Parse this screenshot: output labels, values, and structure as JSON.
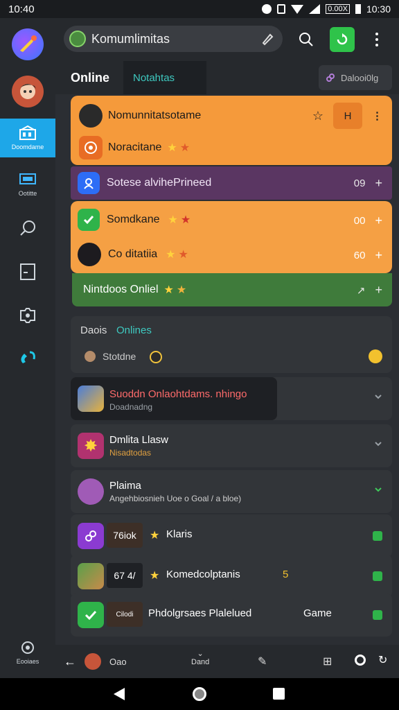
{
  "status": {
    "time": "10:40",
    "right_time": "10:30",
    "battery_label": "0.00X"
  },
  "rail": {
    "items": [
      {
        "label": "Doomdame"
      },
      {
        "label": "Ootitte"
      }
    ],
    "bottom_label": "Eooiaes"
  },
  "topbar": {
    "search_label": "Komumlimitas"
  },
  "tabs": {
    "online": "Online",
    "contacts": "Notahtas",
    "right": "Dalooi0lg"
  },
  "orange_card": {
    "row1": {
      "title": "Nomunnitatsotame",
      "btn": "H"
    },
    "row2": {
      "title": "Noracitane"
    }
  },
  "purple_row": {
    "title": "Sotese alvihePrineed",
    "count": "09"
  },
  "orange_card2": {
    "row1": {
      "title": "Somdkane",
      "count": "00"
    },
    "row2": {
      "title": "Co ditatiia",
      "count": "60"
    }
  },
  "green_row": {
    "title": "Nintdoos Onliel"
  },
  "dark_card": {
    "label1": "Daois",
    "label2": "Onlines",
    "sub": "Stotdne"
  },
  "list": [
    {
      "title": "Suoddn Onlaohtdams. nhingo",
      "subtitle": "Doadnadng",
      "title_color": "#ff6b6b",
      "sub_color": "#9aa0a6"
    },
    {
      "title": "Dmlita Llasw",
      "subtitle": "Nisadtodas",
      "sub_color": "#e0a040"
    },
    {
      "title": "Plaima",
      "subtitle": "Angehbiosnieh Uoe o Goal / a bloe)",
      "sub_color": "#cfcfcf"
    },
    {
      "title": "Klaris",
      "badge": "76iok",
      "sub_color": "#fff"
    },
    {
      "title": "Komedcolptanis",
      "badge": "67 4/",
      "sub_color": "#fff",
      "count": "5"
    },
    {
      "title": "Phdolgrsaes Plalelued",
      "badge": "Cilodi",
      "game": "Game",
      "sub_color": "#fff"
    }
  ],
  "bottombar": {
    "left_label": "Oao",
    "center_label": "Dand"
  },
  "colors": {
    "accent_teal": "#3ec9c0",
    "orange": "#f59a3b",
    "purple": "#5a3662",
    "green": "#3f7b3b",
    "rail_selected": "#1ea7e8"
  }
}
